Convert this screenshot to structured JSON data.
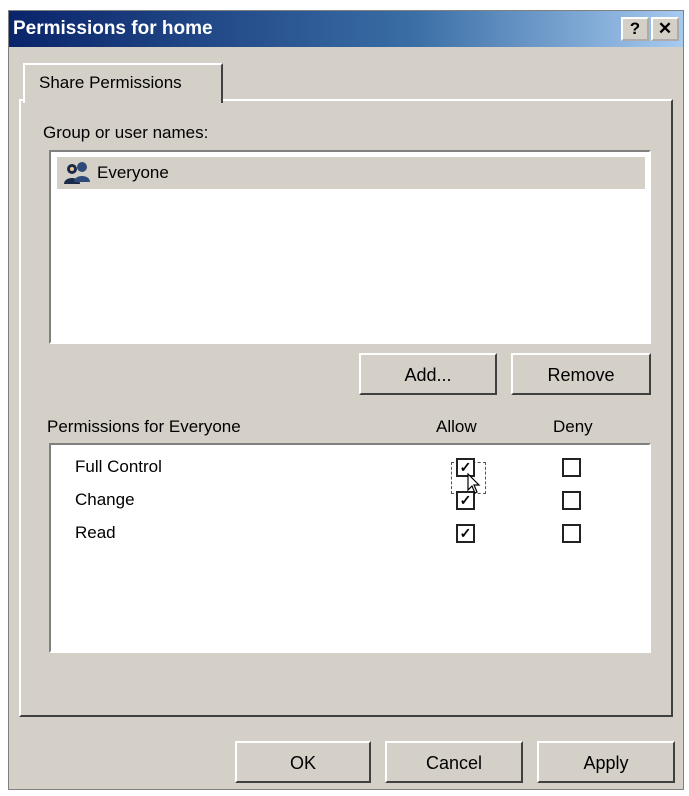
{
  "dialog": {
    "title": "Permissions for home",
    "help_label": "?",
    "close_label": "✕"
  },
  "tab": {
    "label": "Share Permissions"
  },
  "groups": {
    "label": "Group or user names:",
    "items": [
      {
        "name": "Everyone",
        "icon": "users-icon",
        "selected": true
      }
    ]
  },
  "buttons": {
    "add": "Add...",
    "remove": "Remove",
    "ok": "OK",
    "cancel": "Cancel",
    "apply": "Apply"
  },
  "permissions": {
    "label": "Permissions for Everyone",
    "allow_header": "Allow",
    "deny_header": "Deny",
    "rows": [
      {
        "name": "Full Control",
        "allow": true,
        "deny": false
      },
      {
        "name": "Change",
        "allow": true,
        "deny": false
      },
      {
        "name": "Read",
        "allow": true,
        "deny": false
      }
    ]
  }
}
